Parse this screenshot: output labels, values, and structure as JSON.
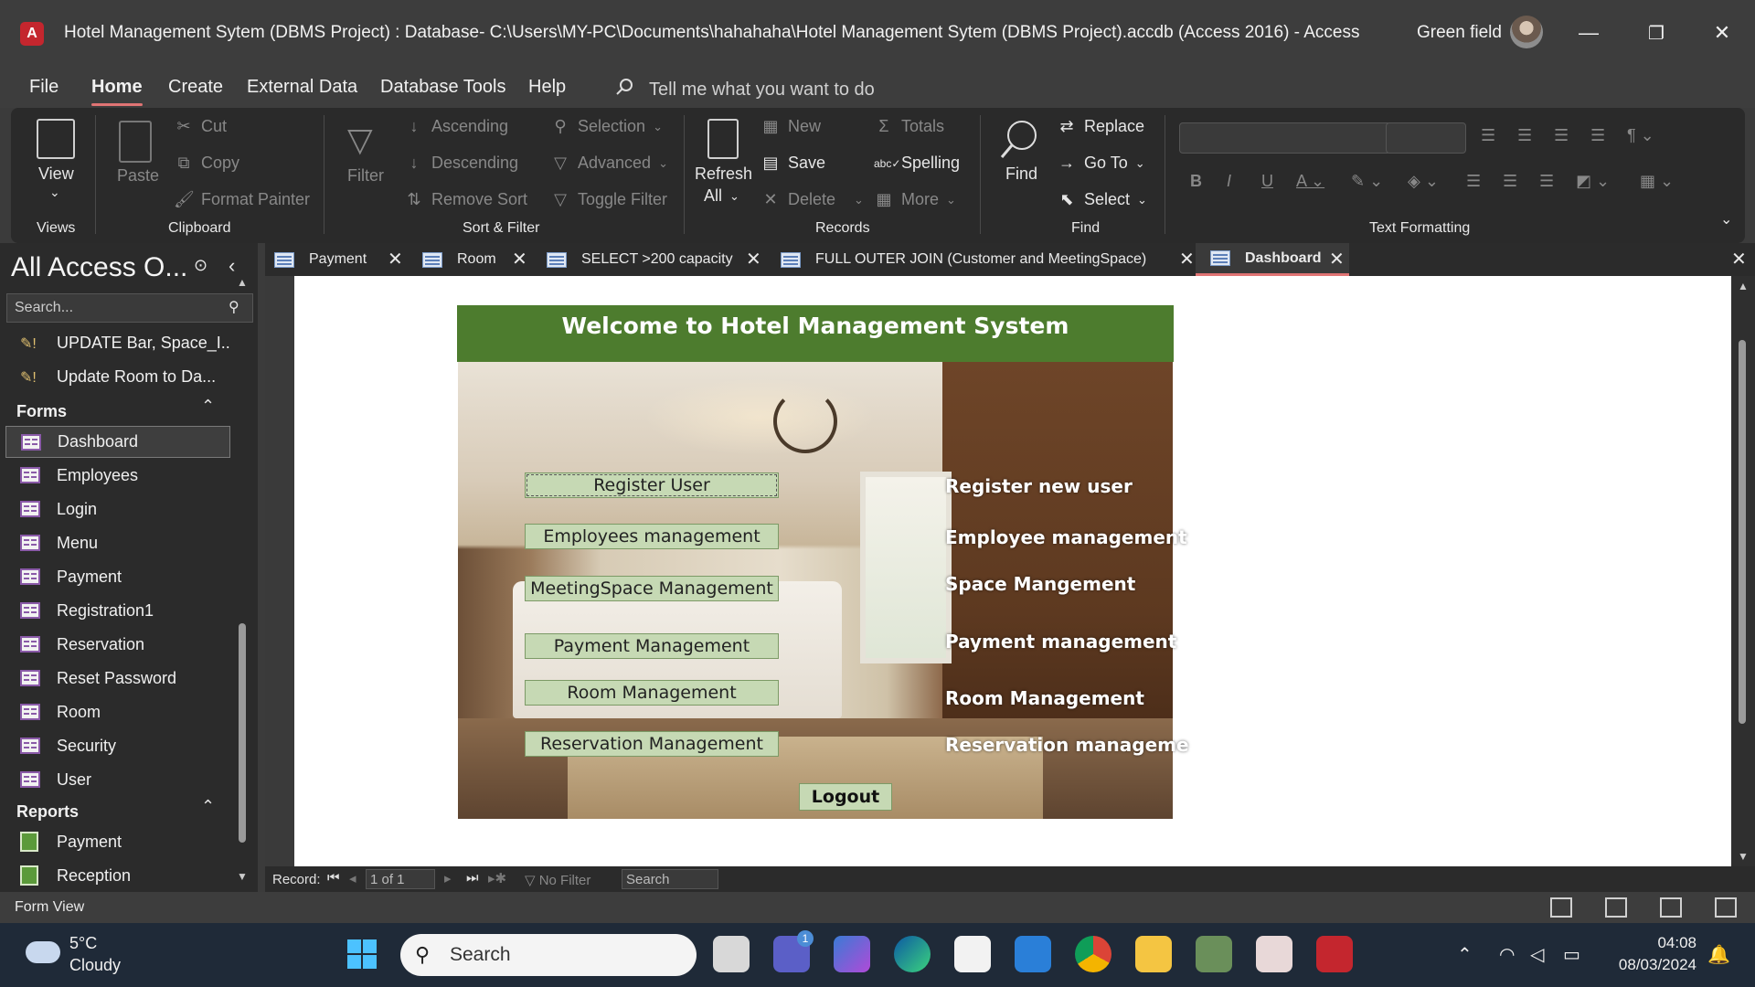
{
  "window": {
    "app_badge": "A",
    "title": "Hotel Management Sytem (DBMS Project) : Database- C:\\Users\\MY-PC\\Documents\\hahahaha\\Hotel Management Sytem (DBMS Project).accdb (Access 2016)  -  Access",
    "user_name": "Green field",
    "minimize": "—",
    "restore": "❐",
    "close": "✕"
  },
  "menu": {
    "items": [
      "File",
      "Home",
      "Create",
      "External Data",
      "Database Tools",
      "Help"
    ],
    "active": "Home",
    "tell_me": "Tell me what you want to do"
  },
  "ribbon": {
    "views": {
      "label": "Views",
      "view": "View"
    },
    "clipboard": {
      "label": "Clipboard",
      "paste": "Paste",
      "cut": "Cut",
      "copy": "Copy",
      "format_painter": "Format Painter"
    },
    "sort_filter": {
      "label": "Sort & Filter",
      "filter": "Filter",
      "ascending": "Ascending",
      "descending": "Descending",
      "remove_sort": "Remove Sort",
      "selection": "Selection",
      "advanced": "Advanced",
      "toggle_filter": "Toggle Filter"
    },
    "records": {
      "label": "Records",
      "refresh": "Refresh",
      "refresh_all": "All",
      "new": "New",
      "save": "Save",
      "delete": "Delete",
      "totals": "Totals",
      "spelling": "Spelling",
      "more": "More"
    },
    "find": {
      "label": "Find",
      "find": "Find",
      "replace": "Replace",
      "go_to": "Go To",
      "select": "Select"
    },
    "text_formatting": {
      "label": "Text Formatting"
    }
  },
  "nav": {
    "title": "All Access O...",
    "search_placeholder": "Search...",
    "queries": [
      "UPDATE Bar, Space_I...",
      "Update Room to Da..."
    ],
    "forms_label": "Forms",
    "forms": [
      "Dashboard",
      "Employees",
      "Login",
      "Menu",
      "Payment",
      "Registration1",
      "Reservation",
      "Reset Password",
      "Room",
      "Security",
      "User"
    ],
    "selected_form": "Dashboard",
    "reports_label": "Reports",
    "reports": [
      "Payment",
      "Reception"
    ]
  },
  "tabs": [
    {
      "label": "Payment"
    },
    {
      "label": "Room"
    },
    {
      "label": "SELECT >200 capacity"
    },
    {
      "label": "FULL OUTER JOIN (Customer and MeetingSpace)"
    },
    {
      "label": "Dashboard"
    }
  ],
  "active_tab": "Dashboard",
  "form": {
    "heading": "Welcome to Hotel Management System",
    "buttons": [
      "Register User",
      "Employees management",
      "MeetingSpace Management",
      "Payment Management",
      "Room Management",
      "Reservation Management"
    ],
    "labels": [
      "Register new user",
      "Employee management",
      "Space Mangement",
      "Payment management",
      "Room Management",
      "Reservation manageme"
    ],
    "logout": "Logout"
  },
  "record_nav": {
    "label": "Record:",
    "position": "1 of 1",
    "filter": "No Filter",
    "search": "Search"
  },
  "status": {
    "view": "Form View"
  },
  "taskbar": {
    "temperature": "5°C",
    "condition": "Cloudy",
    "search": "Search",
    "time": "04:08",
    "date": "08/03/2024",
    "chat_badge": "1"
  }
}
